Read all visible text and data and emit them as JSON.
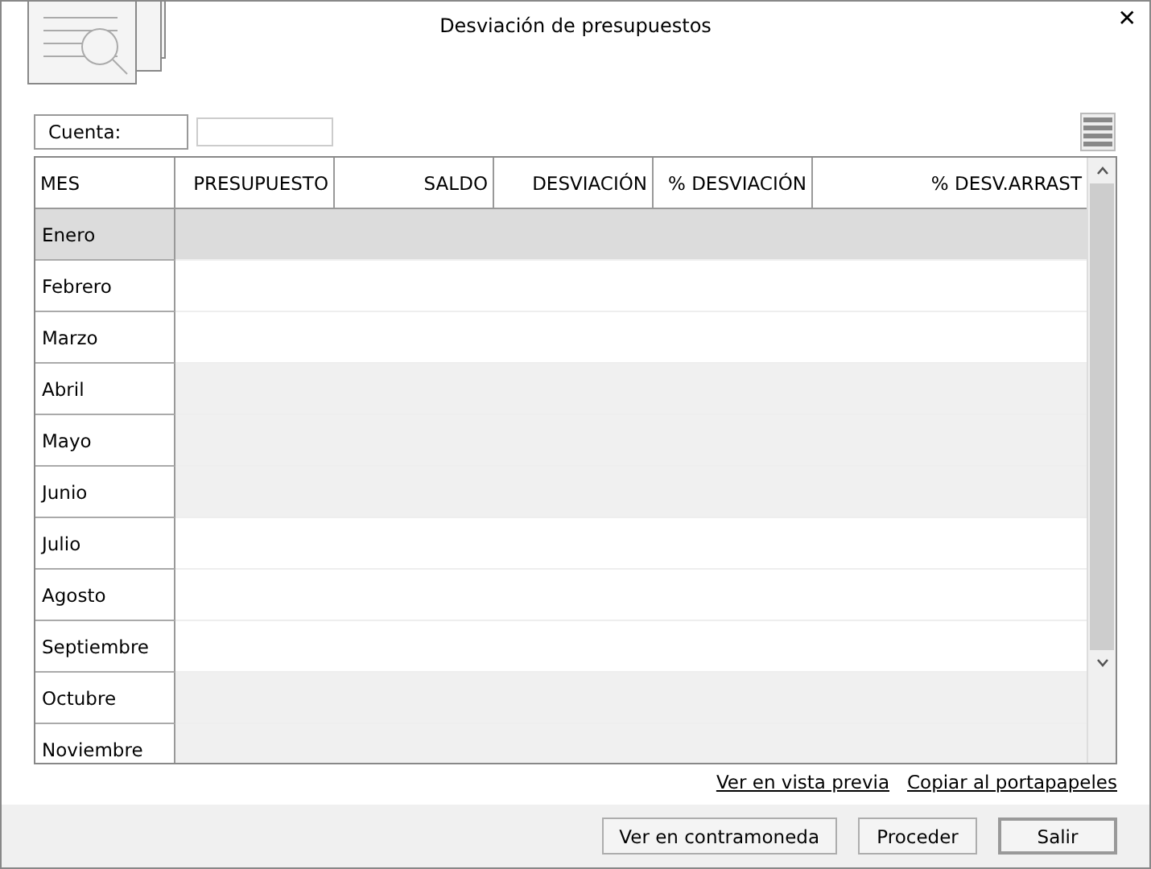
{
  "window": {
    "title": "Desviación de presupuestos",
    "close": "✕"
  },
  "account": {
    "label": "Cuenta:"
  },
  "table": {
    "columns": [
      "MES",
      "PRESUPUESTO",
      "SALDO",
      "DESVIACIÓN",
      "% DESVIACIÓN",
      "% DESV.ARRAST"
    ],
    "rows": [
      {
        "month": "Enero",
        "selected": true
      },
      {
        "month": "Febrero",
        "selected": false
      },
      {
        "month": "Marzo",
        "selected": false
      },
      {
        "month": "Abril",
        "selected": false
      },
      {
        "month": "Mayo",
        "selected": false
      },
      {
        "month": "Junio",
        "selected": false
      },
      {
        "month": "Julio",
        "selected": false
      },
      {
        "month": "Agosto",
        "selected": false
      },
      {
        "month": "Septiembre",
        "selected": false
      },
      {
        "month": "Octubre",
        "selected": false
      },
      {
        "month": "Noviembre",
        "selected": false
      }
    ]
  },
  "links": [
    "Ver en vista previa",
    "Copiar al portapapeles"
  ],
  "buttons": [
    {
      "label": "Ver en contramoneda",
      "default": false
    },
    {
      "label": "Proceder",
      "default": false
    },
    {
      "label": "Salir",
      "default": true
    }
  ]
}
